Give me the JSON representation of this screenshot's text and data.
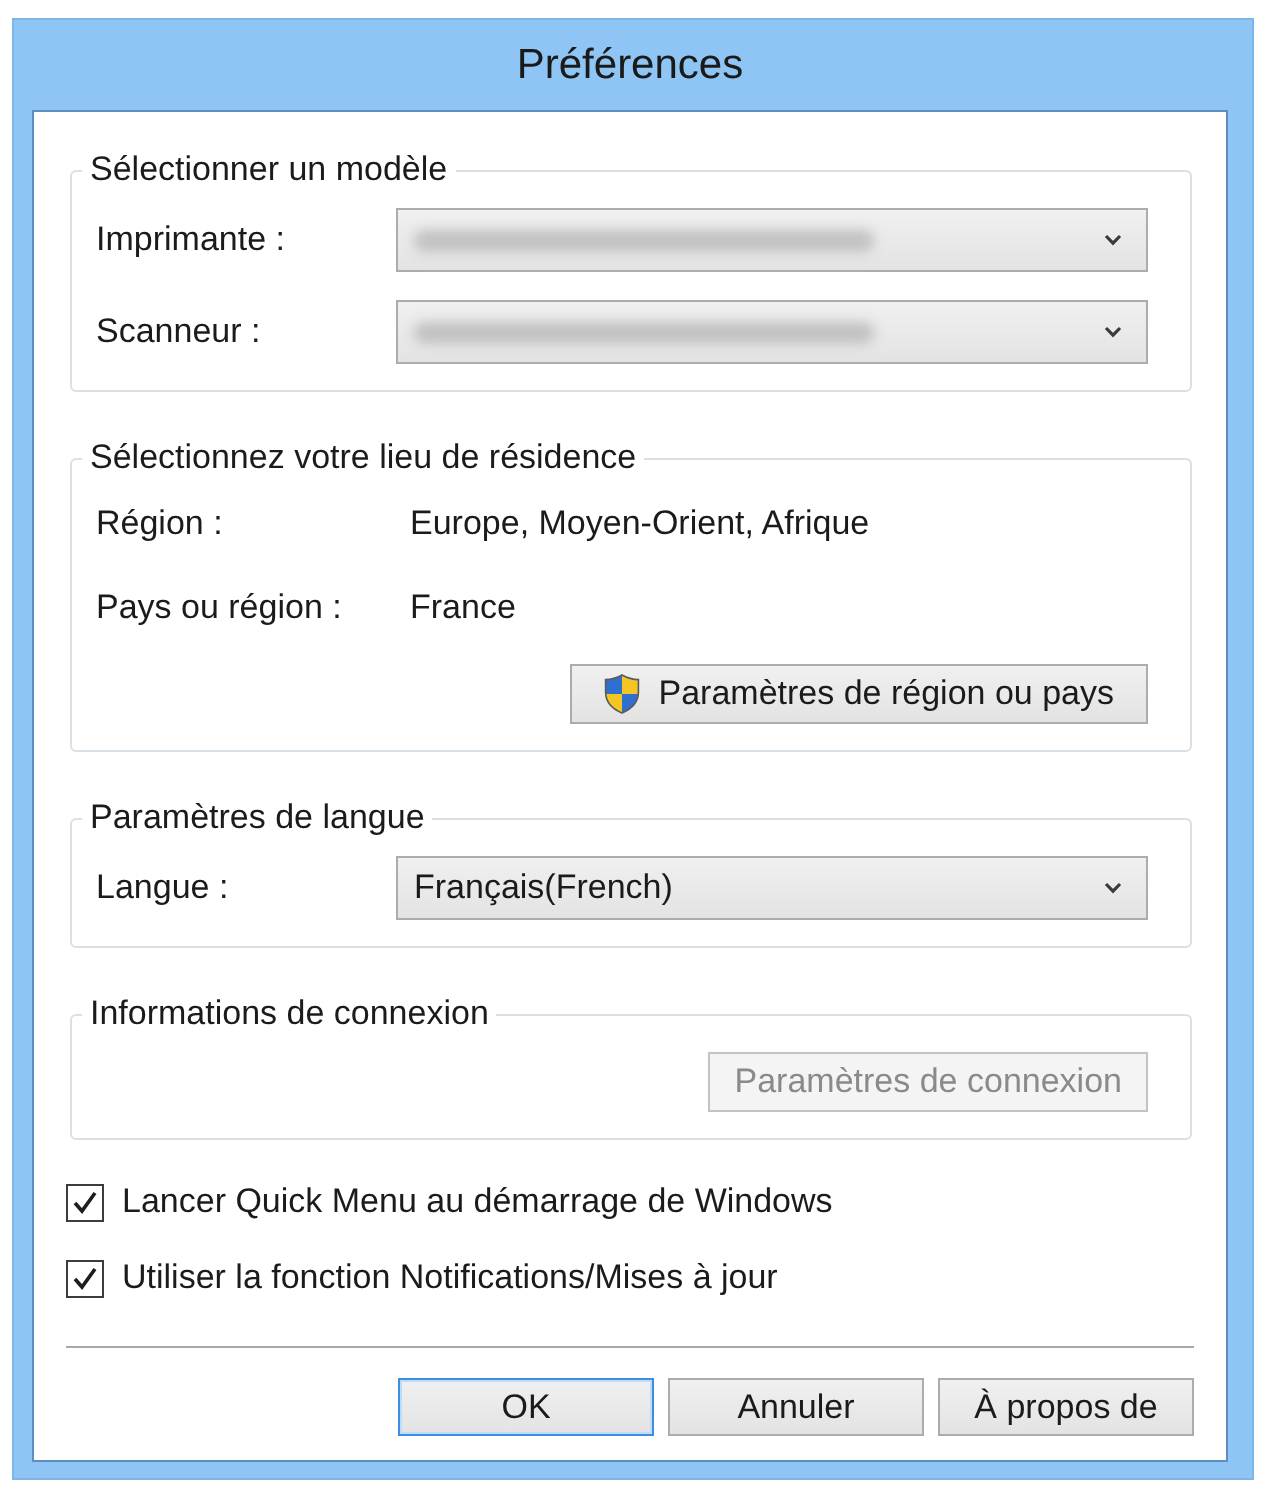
{
  "window": {
    "title": "Préférences"
  },
  "groups": [
    {
      "legend": "Sélectionner un modèle",
      "rows": [
        {
          "kind": "select",
          "label": "Imprimante :",
          "blurred": true
        },
        {
          "kind": "select",
          "label": "Scanneur :",
          "blurred": true
        }
      ]
    },
    {
      "legend": "Sélectionnez votre lieu de résidence",
      "rows": [
        {
          "kind": "text",
          "label": "Région :",
          "value": "Europe, Moyen-Orient, Afrique"
        },
        {
          "kind": "text",
          "label": "Pays ou région :",
          "value": "France"
        },
        {
          "kind": "button",
          "label": "Paramètres de région ou pays",
          "shield": true,
          "disabled": false
        }
      ]
    },
    {
      "legend": "Paramètres de langue",
      "rows": [
        {
          "kind": "select",
          "label": "Langue :",
          "value": "Français(French)"
        }
      ]
    },
    {
      "legend": "Informations de connexion",
      "rows": [
        {
          "kind": "button",
          "label": "Paramètres de connexion",
          "disabled": true
        }
      ]
    }
  ],
  "checkboxes": [
    {
      "label": "Lancer Quick Menu au démarrage de Windows",
      "checked": true
    },
    {
      "label": "Utiliser la fonction Notifications/Mises à jour",
      "checked": true
    }
  ],
  "buttons": [
    {
      "label": "OK",
      "focused": true
    },
    {
      "label": "Annuler",
      "focused": false
    },
    {
      "label": "À propos de",
      "focused": false
    }
  ]
}
